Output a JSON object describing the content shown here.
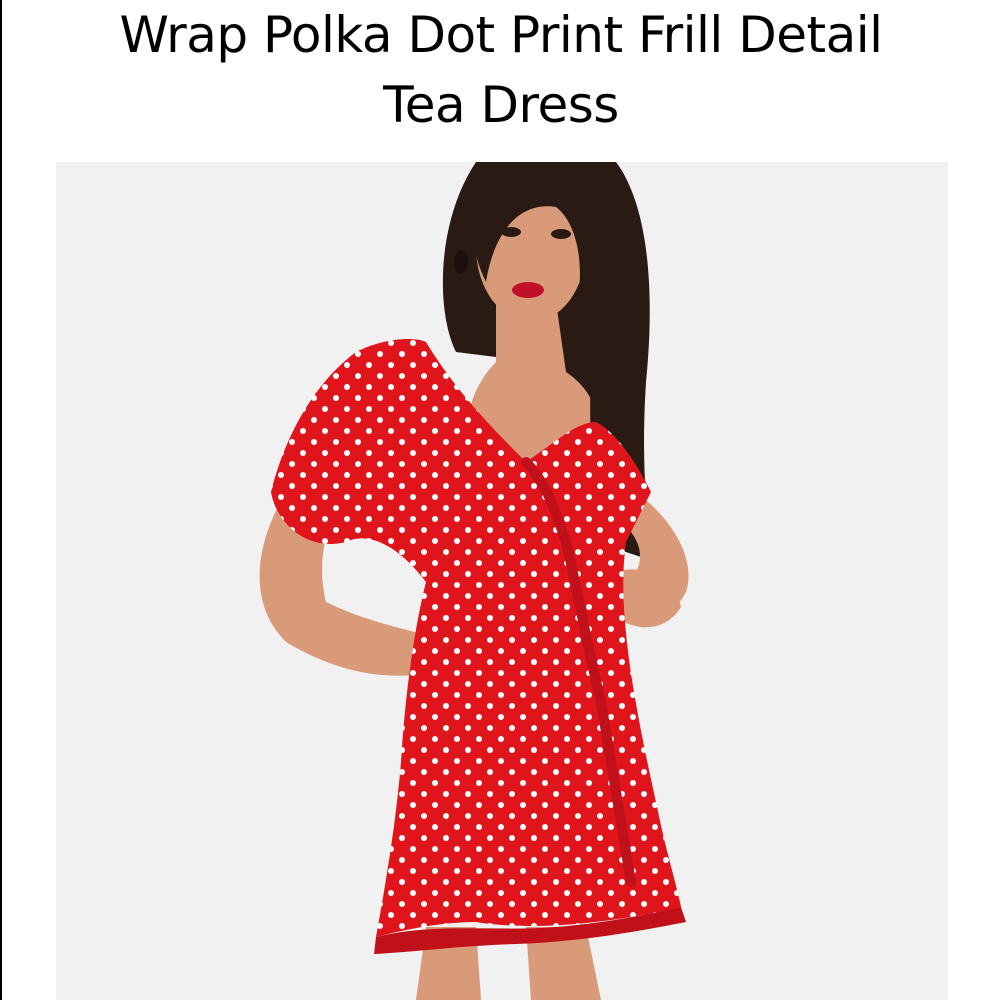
{
  "product": {
    "title_line1": "Wrap Polka Dot Print Frill Detail",
    "title_line2": "Tea Dress",
    "image_alt": "Model wearing a red polka dot wrap tea dress with frill detail",
    "colors": {
      "background": "#ffffff",
      "photo_background": "#f1f1f1",
      "dress_red": "#e0141b",
      "dots": "#ffffff",
      "skin": "#d99a7a",
      "hair": "#2a1a14",
      "lips": "#c0102a"
    }
  }
}
